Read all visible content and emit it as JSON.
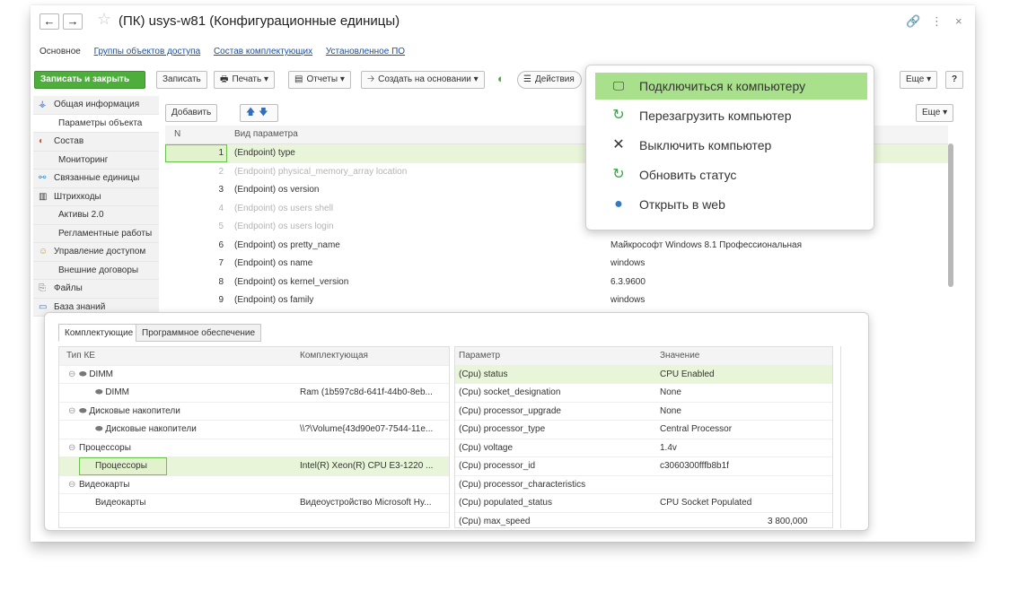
{
  "titlebar": {
    "back_label": "←",
    "forward_label": "→",
    "star_label": "☆",
    "title": "(ПК) usys-w81 (Конфигурационные единицы)",
    "link_icon": "🔗",
    "more_icon": "⋮",
    "close_icon": "×"
  },
  "sections": [
    {
      "label": "Основное"
    },
    {
      "label": "Группы объектов доступа"
    },
    {
      "label": "Состав комплектующих"
    },
    {
      "label": "Установленное ПО"
    }
  ],
  "toolbar": {
    "save_close": "Записать и закрыть",
    "save": "Записать",
    "print": "Печать",
    "reports": "Отчеты",
    "create_based": "Создать на основании",
    "actions": "Действия",
    "more": "Еще",
    "help": "?",
    "dropdown_glyph": "▾"
  },
  "leftnav": [
    {
      "label": "Общая информация",
      "icon": "tree-icon"
    },
    {
      "label": "Параметры объекта",
      "icon": ""
    },
    {
      "label": "Состав",
      "icon": "composition-icon"
    },
    {
      "label": "Мониторинг",
      "icon": ""
    },
    {
      "label": "Связанные единицы",
      "icon": "link-icon"
    },
    {
      "label": "Штрихкоды",
      "icon": "barcode-icon"
    },
    {
      "label": "Активы 2.0",
      "icon": ""
    },
    {
      "label": "Регламентные работы",
      "icon": ""
    },
    {
      "label": "Управление доступом",
      "icon": "users-icon"
    },
    {
      "label": "Внешние договоры",
      "icon": ""
    },
    {
      "label": "Файлы",
      "icon": "paperclip-icon"
    },
    {
      "label": "База знаний",
      "icon": "book-icon"
    }
  ],
  "params": {
    "add_label": "Добавить",
    "up_label": "🡅",
    "down_label": "🡇",
    "more_label": "Еще",
    "col_n": "N",
    "col_name": "Вид параметра",
    "rows": [
      {
        "n": "1",
        "name": "(Endpoint) type",
        "value": ""
      },
      {
        "n": "2",
        "name": "(Endpoint) physical_memory_array location",
        "value": ""
      },
      {
        "n": "3",
        "name": "(Endpoint) os version",
        "value": ""
      },
      {
        "n": "4",
        "name": "(Endpoint) os users shell",
        "value": ""
      },
      {
        "n": "5",
        "name": "(Endpoint) os users login",
        "value": ""
      },
      {
        "n": "6",
        "name": "(Endpoint) os pretty_name",
        "value": "Майкрософт Windows 8.1 Профессиональная"
      },
      {
        "n": "7",
        "name": "(Endpoint) os name",
        "value": "windows"
      },
      {
        "n": "8",
        "name": "(Endpoint) os kernel_version",
        "value": "6.3.9600"
      },
      {
        "n": "9",
        "name": "(Endpoint) os family",
        "value": "windows"
      }
    ]
  },
  "popup": {
    "items": [
      {
        "label": "Подключиться к компьютеру",
        "icon": "monitor-icon"
      },
      {
        "label": "Перезагрузить компьютер",
        "icon": "refresh-icon"
      },
      {
        "label": "Выключить компьютер",
        "icon": "close-icon"
      },
      {
        "label": "Обновить статус",
        "icon": "refresh-icon"
      },
      {
        "label": "Открыть в web",
        "icon": "globe-icon"
      }
    ]
  },
  "components": {
    "tabs": [
      {
        "label": "Комплектующие"
      },
      {
        "label": "Программное обеспечение"
      }
    ],
    "left_headers": {
      "type": "Тип КЕ",
      "component": "Комплектующая"
    },
    "left_rows": [
      {
        "type": "DIMM",
        "component": ""
      },
      {
        "type": "DIMM",
        "component": "Ram (1b597c8d-641f-44b0-8eb..."
      },
      {
        "type": "Дисковые накопители",
        "component": ""
      },
      {
        "type": "Дисковые накопители",
        "component": "\\\\?\\Volume{43d90e07-7544-11e..."
      },
      {
        "type": "Процессоры",
        "component": ""
      },
      {
        "type": "Процессоры",
        "component": "Intel(R) Xeon(R) CPU E3-1220 ..."
      },
      {
        "type": "Видеокарты",
        "component": ""
      },
      {
        "type": "Видеокарты",
        "component": "Видеоустройство Microsoft Hy..."
      }
    ],
    "right_headers": {
      "param": "Параметр",
      "value": "Значение"
    },
    "right_rows": [
      {
        "param": "(Cpu) status",
        "value": "CPU Enabled"
      },
      {
        "param": "(Cpu) socket_designation",
        "value": "None"
      },
      {
        "param": "(Cpu) processor_upgrade",
        "value": "None"
      },
      {
        "param": "(Cpu) processor_type",
        "value": "Central Processor"
      },
      {
        "param": "(Cpu) voltage",
        "value": "1.4v"
      },
      {
        "param": "(Cpu) processor_id",
        "value": "c3060300fffb8b1f"
      },
      {
        "param": "(Cpu) processor_characteristics",
        "value": ""
      },
      {
        "param": "(Cpu) populated_status",
        "value": "CPU Socket Populated"
      },
      {
        "param": "(Cpu) max_speed",
        "value": "3 800,000"
      }
    ],
    "tree_glyph": "⊖",
    "dimm_glyph": "⬬",
    "disk_glyph": "⬬"
  },
  "colors": {
    "accent": "#4dae3c",
    "selection": "#e9f5d9",
    "highlight": "#a8e08b"
  }
}
